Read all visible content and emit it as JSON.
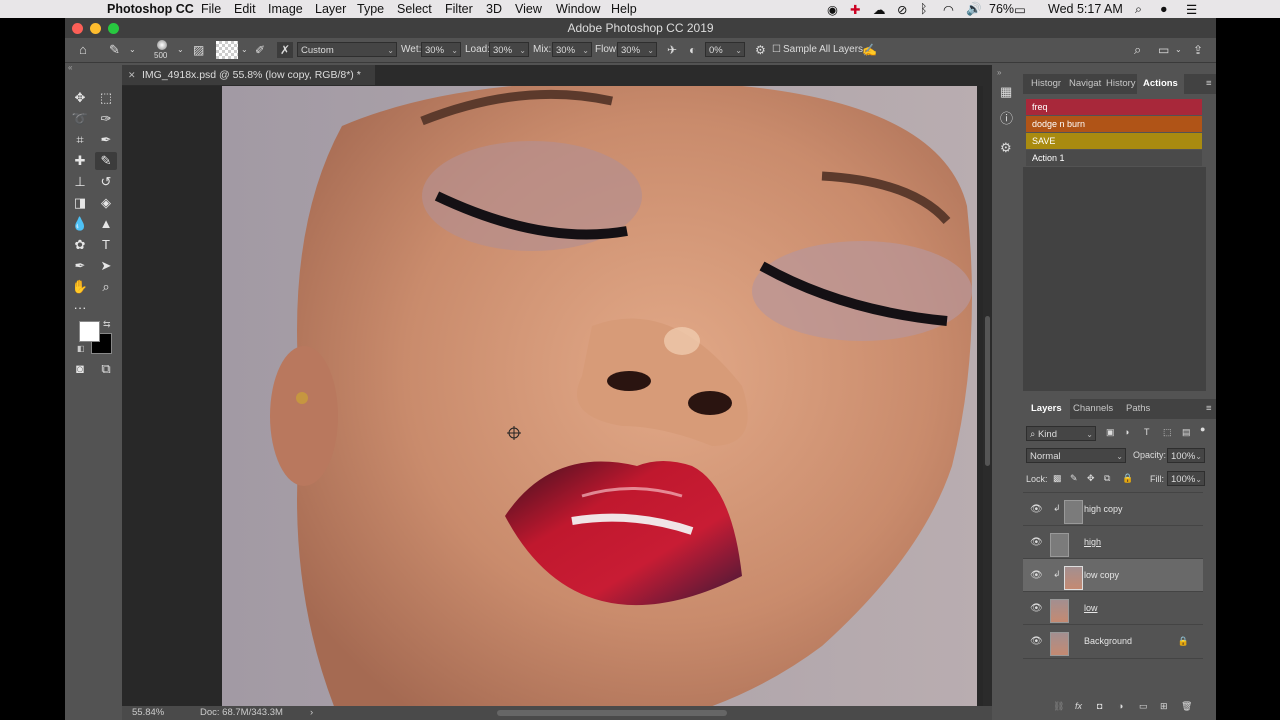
{
  "menubar": {
    "app": "Photoshop CC",
    "items": [
      "File",
      "Edit",
      "Image",
      "Layer",
      "Type",
      "Select",
      "Filter",
      "3D",
      "View",
      "Window",
      "Help"
    ],
    "battery": "76%",
    "clock": "Wed 5:17 AM"
  },
  "window": {
    "title": "Adobe Photoshop CC 2019"
  },
  "options": {
    "brush_size": "500",
    "preset": "Custom",
    "wet_label": "Wet:",
    "wet_value": "30%",
    "load_label": "Load:",
    "load_value": "30%",
    "mix_label": "Mix:",
    "mix_value": "30%",
    "flow_label": "Flow:",
    "flow_value": "30%",
    "angle_value": "0%",
    "sample_all_label": "Sample All Layers"
  },
  "document": {
    "tab_title": "IMG_4918x.psd @ 55.8% (low copy, RGB/8*) *",
    "zoom": "55.84%",
    "doc_size": "Doc: 68.7M/343.3M"
  },
  "top_panel": {
    "tabs": [
      "Histogr",
      "Navigat",
      "History",
      "Actions"
    ],
    "active_tab": "Actions",
    "actions": [
      {
        "label": "freq",
        "color": "#a8283a"
      },
      {
        "label": "dodge n burn",
        "color": "#b05417"
      },
      {
        "label": "SAVE",
        "color": "#a98b10"
      },
      {
        "label": "Action 1",
        "color": "#4a4a4a"
      }
    ]
  },
  "layers_panel": {
    "tabs": [
      "Layers",
      "Channels",
      "Paths"
    ],
    "active_tab": "Layers",
    "filter_kind": "Kind",
    "blend_mode": "Normal",
    "opacity_label": "Opacity:",
    "opacity_value": "100%",
    "lock_label": "Lock:",
    "fill_label": "Fill:",
    "fill_value": "100%",
    "layers": [
      {
        "name": "high copy",
        "thumb": "gray",
        "clipped": true,
        "underline": false,
        "selected": false,
        "locked": false
      },
      {
        "name": "high",
        "thumb": "gray",
        "clipped": false,
        "underline": true,
        "selected": false,
        "locked": false
      },
      {
        "name": "low copy",
        "thumb": "face",
        "clipped": true,
        "underline": false,
        "selected": true,
        "locked": false
      },
      {
        "name": "low",
        "thumb": "face",
        "clipped": false,
        "underline": true,
        "selected": false,
        "locked": false
      },
      {
        "name": "Background",
        "thumb": "face",
        "clipped": false,
        "underline": false,
        "selected": false,
        "locked": true
      }
    ]
  },
  "colors": {
    "foreground": "#ffffff",
    "background": "#000000",
    "ui_bg": "#535353",
    "ui_dark": "#3c3c3c"
  }
}
